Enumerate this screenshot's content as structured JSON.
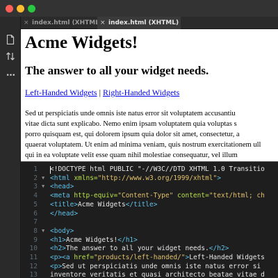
{
  "window": {
    "dots": {
      "close": "#ff5f57",
      "minimize": "#febc2e",
      "zoom": "#28c840"
    }
  },
  "tabs": [
    {
      "label": "index.html (XHTML)",
      "active": false
    },
    {
      "label": "index.html (XHTML)",
      "active": true
    }
  ],
  "tab_close_glyph": "×",
  "toolbar": {
    "icons": [
      "file-icon",
      "sort-arrows-icon",
      "more-icon"
    ],
    "more_glyph": "•••"
  },
  "preview": {
    "heading": "Acme Widgets!",
    "subheading": "The answer to all your widget needs.",
    "link_left": "Left-Handed Widgets",
    "link_separator": "|",
    "link_right": "Right-Handed Widgets",
    "paragraph_lines": [
      "Sed ut perspiciatis unde omnis iste natus error sit voluptatem accusantiu",
      "vitae dicta sunt explicabo. Nemo enim ipsam voluptatem quia voluptas s",
      "porro quisquam est, qui dolorem ipsum quia dolor sit amet, consectetur, a",
      "quaerat voluptatem. Ut enim ad minima veniam, quis nostrum exercitationem ull",
      "qui in ea voluptate velit esse quam nihil molestiae consequatur, vel illum"
    ]
  },
  "editor": {
    "lines": [
      {
        "n": "1",
        "fold": "",
        "segs": [
          {
            "c": "tx",
            "t": "<!DOCTYPE html PUBLIC \"-//W3C//DTD XHTML 1.0 Transitio"
          }
        ]
      },
      {
        "n": "2",
        "fold": "▼",
        "segs": [
          {
            "c": "tg",
            "t": "<html "
          },
          {
            "c": "at",
            "t": "xmlns="
          },
          {
            "c": "st",
            "t": "\"http://www.w3.org/1999/xhtml\""
          },
          {
            "c": "tg",
            "t": ">"
          }
        ]
      },
      {
        "n": "3",
        "fold": "▼",
        "segs": [
          {
            "c": "tg",
            "t": "<head>"
          }
        ]
      },
      {
        "n": "4",
        "fold": "",
        "segs": [
          {
            "c": "tg",
            "t": "<meta "
          },
          {
            "c": "at",
            "t": "http-equiv="
          },
          {
            "c": "st",
            "t": "\"Content-Type\""
          },
          {
            "c": "at",
            "t": " content="
          },
          {
            "c": "st",
            "t": "\"text/html; ch"
          }
        ]
      },
      {
        "n": "5",
        "fold": "",
        "segs": [
          {
            "c": "tg",
            "t": "<title>"
          },
          {
            "c": "tx",
            "t": "Acme Widgets"
          },
          {
            "c": "tg",
            "t": "</title>"
          }
        ]
      },
      {
        "n": "6",
        "fold": "",
        "segs": [
          {
            "c": "tg",
            "t": "</head>"
          }
        ]
      },
      {
        "n": "7",
        "fold": "",
        "segs": []
      },
      {
        "n": "8",
        "fold": "▼",
        "segs": [
          {
            "c": "tg",
            "t": "<body>"
          }
        ]
      },
      {
        "n": "9",
        "fold": "",
        "segs": [
          {
            "c": "tg",
            "t": "<h1>"
          },
          {
            "c": "tx",
            "t": "Acme Widgets!"
          },
          {
            "c": "tg",
            "t": "</h1>"
          }
        ]
      },
      {
        "n": "10",
        "fold": "",
        "segs": [
          {
            "c": "tg",
            "t": "<h2>"
          },
          {
            "c": "tx",
            "t": "The answer to all your widget needs."
          },
          {
            "c": "tg",
            "t": "</h2>"
          }
        ]
      },
      {
        "n": "11",
        "fold": "",
        "segs": [
          {
            "c": "tg",
            "t": "<p><a "
          },
          {
            "c": "at",
            "t": "href="
          },
          {
            "c": "st",
            "t": "\"products/left-handed/\""
          },
          {
            "c": "tg",
            "t": ">"
          },
          {
            "c": "tx",
            "t": "Left-Handed Widgets"
          }
        ]
      },
      {
        "n": "12",
        "fold": "",
        "segs": [
          {
            "c": "tg",
            "t": "<p>"
          },
          {
            "c": "tx",
            "t": "Sed ut perspiciatis unde omnis iste natus error si"
          }
        ]
      },
      {
        "n": "13",
        "fold": "",
        "segs": [
          {
            "c": "tx",
            "t": "inventore veritatis et quasi architecto beatae vitae d"
          }
        ]
      }
    ]
  }
}
